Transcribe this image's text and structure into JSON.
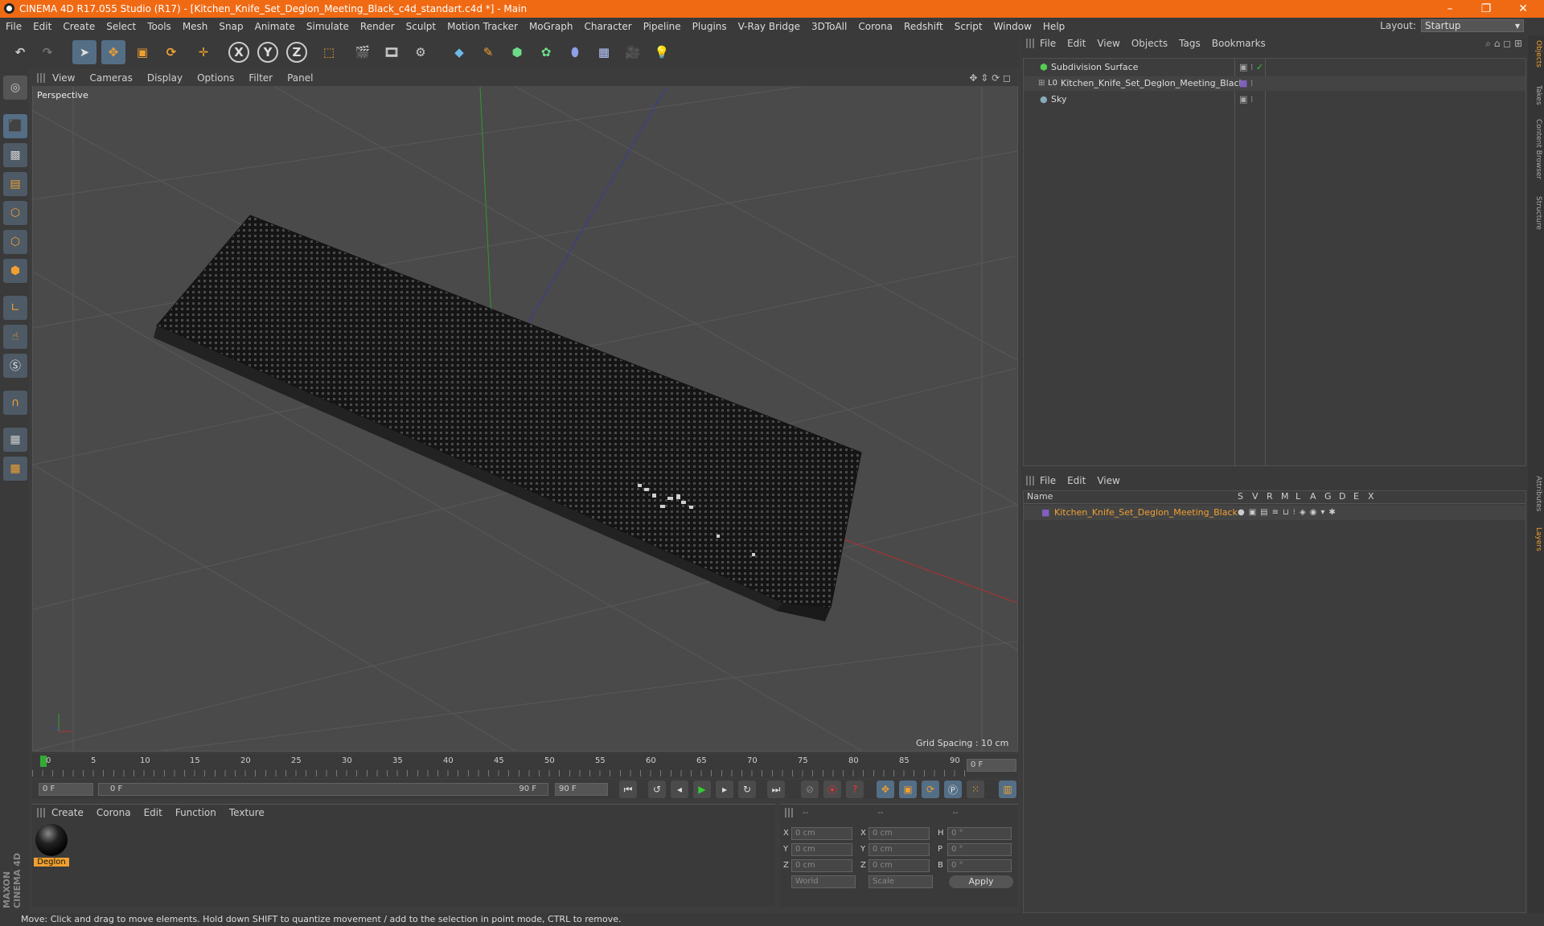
{
  "window": {
    "title": "CINEMA 4D R17.055 Studio (R17) - [Kitchen_Knife_Set_Deglon_Meeting_Black_c4d_standart.c4d *] - Main",
    "minimize": "–",
    "maximize": "❐",
    "close": "✕"
  },
  "menu": [
    "File",
    "Edit",
    "Create",
    "Select",
    "Tools",
    "Mesh",
    "Snap",
    "Animate",
    "Simulate",
    "Render",
    "Sculpt",
    "Motion Tracker",
    "MoGraph",
    "Character",
    "Pipeline",
    "Plugins",
    "V-Ray Bridge",
    "3DToAll",
    "Corona",
    "Redshift",
    "Script",
    "Window",
    "Help"
  ],
  "layout": {
    "label": "Layout:",
    "value": "Startup"
  },
  "toolbar": {
    "x": "X",
    "y": "Y",
    "z": "Z"
  },
  "viewport": {
    "menu": [
      "View",
      "Cameras",
      "Display",
      "Options",
      "Filter",
      "Panel"
    ],
    "camera": "Perspective",
    "grid_spacing": "Grid Spacing : 10 cm"
  },
  "timeline": {
    "ticks": [
      "0",
      "5",
      "10",
      "15",
      "20",
      "25",
      "30",
      "35",
      "40",
      "45",
      "50",
      "55",
      "60",
      "65",
      "70",
      "75",
      "80",
      "85",
      "90"
    ],
    "frame_field": "0 F"
  },
  "transport": {
    "start": "0 F",
    "range_start": "0 F",
    "range_end": "90 F",
    "end": "90 F"
  },
  "materials": {
    "menu": [
      "Create",
      "Corona",
      "Edit",
      "Function",
      "Texture"
    ],
    "items": [
      {
        "name": "Deglon"
      }
    ]
  },
  "attributes": {
    "header": [
      "--",
      "--",
      "--"
    ],
    "rows": [
      {
        "a": "X",
        "av": "0 cm",
        "b": "X",
        "bv": "0 cm",
        "c": "H",
        "cv": "0 °"
      },
      {
        "a": "Y",
        "av": "0 cm",
        "b": "Y",
        "bv": "0 cm",
        "c": "P",
        "cv": "0 °"
      },
      {
        "a": "Z",
        "av": "0 cm",
        "b": "Z",
        "bv": "0 cm",
        "c": "B",
        "cv": "0 °"
      }
    ],
    "coord_mode": "World",
    "size_mode": "Scale",
    "apply": "Apply"
  },
  "objects": {
    "menu": [
      "File",
      "Edit",
      "View",
      "Objects",
      "Tags",
      "Bookmarks"
    ],
    "items": [
      {
        "name": "Subdivision Surface"
      },
      {
        "name": "Kitchen_Knife_Set_Deglon_Meeting_Black"
      },
      {
        "name": "Sky"
      }
    ]
  },
  "layers": {
    "menu": [
      "File",
      "Edit",
      "View"
    ],
    "columns": [
      "Name",
      "S",
      "V",
      "R",
      "M",
      "L",
      "A",
      "G",
      "D",
      "E",
      "X"
    ],
    "items": [
      {
        "name": "Kitchen_Knife_Set_Deglon_Meeting_Black"
      }
    ]
  },
  "sidetabs": [
    "Objects",
    "Takes",
    "Content Browser",
    "Structure",
    "Attributes",
    "Layers"
  ],
  "status": "Move: Click and drag to move elements. Hold down SHIFT to quantize movement / add to the selection in point mode, CTRL to remove.",
  "brand": "MAXON CINEMA 4D",
  "colors": {
    "title_bar": "#f06a14",
    "accent_orange": "#f0a030",
    "selected_blue": "#546e86"
  }
}
